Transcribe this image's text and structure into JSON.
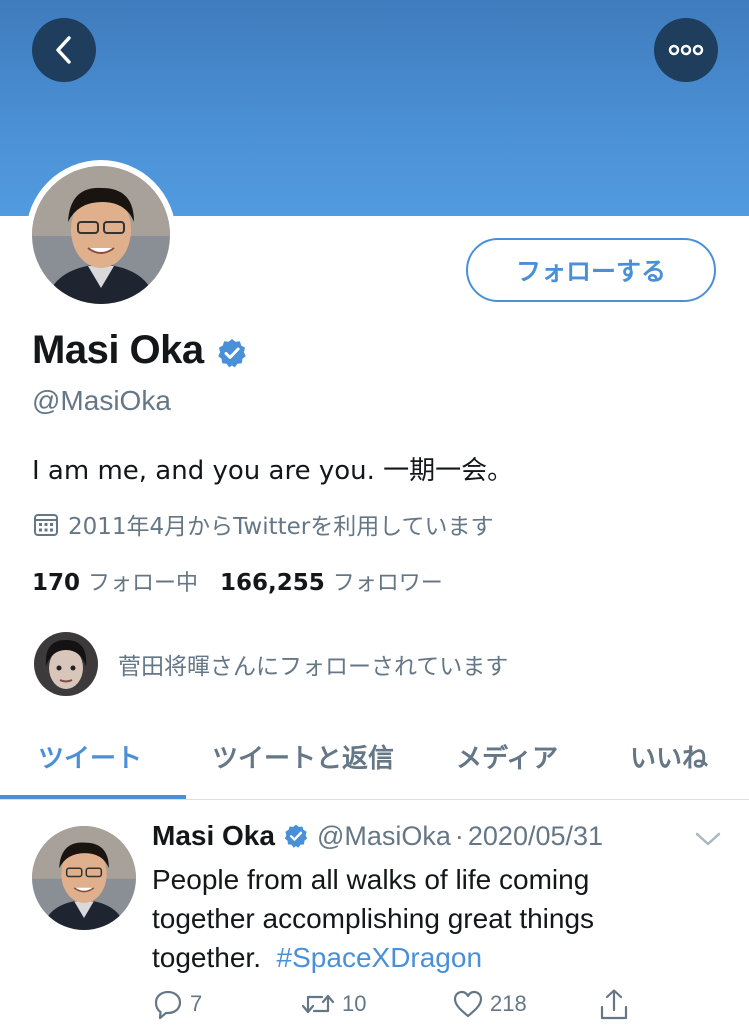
{
  "header": {
    "back_icon": "chevron-left-icon",
    "more_icon": "more-horizontal-icon",
    "banner_color": "#4a8fd3"
  },
  "profile": {
    "follow_label": "フォローする",
    "name": "Masi Oka",
    "handle": "@MasiOka",
    "bio": "I am me, and you are you. 一期一会。",
    "joined": "2011年4月からTwitterを利用しています",
    "following_count": "170",
    "following_label": "フォロー中",
    "followers_count": "166,255",
    "followers_label": "フォロワー",
    "followed_by": "菅田将暉さんにフォローされています"
  },
  "tabs": [
    {
      "label": "ツイート",
      "active": true
    },
    {
      "label": "ツイートと返信"
    },
    {
      "label": "メディア"
    },
    {
      "label": "いいね"
    }
  ],
  "tweet": {
    "name": "Masi Oka",
    "handle": "@MasiOka",
    "separator": "·",
    "date": "2020/05/31",
    "text": "People from all walks of life coming together accomplishing great things together.",
    "hashtag": "#SpaceXDragon",
    "replies": "7",
    "retweets": "10",
    "likes": "218"
  },
  "colors": {
    "accent": "#4a90d9",
    "secondary_text": "#657786",
    "primary_text": "#14171a"
  }
}
